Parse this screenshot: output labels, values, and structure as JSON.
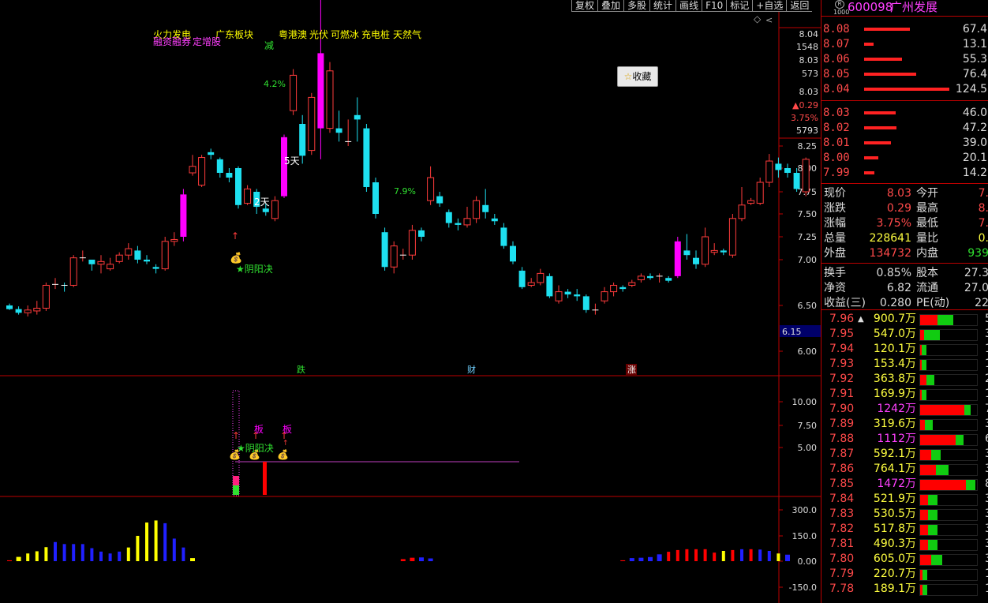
{
  "toolbar": [
    "复权",
    "叠加",
    "多股",
    "统计",
    "画线",
    "F10",
    "标记",
    "+自选",
    "返回"
  ],
  "stock": {
    "badge_r": "R",
    "badge_n": "1000",
    "code": "600098",
    "name": "广州发展"
  },
  "favorite": {
    "icon": "star-icon",
    "label": "收藏"
  },
  "concepts": [
    {
      "text": "火力发电",
      "color": "#ffff00"
    },
    {
      "text": "广东板块",
      "color": "#ffff00"
    },
    {
      "text": "粤港澳",
      "color": "#ffff00"
    },
    {
      "text": "光伏",
      "color": "#ffff00"
    },
    {
      "text": "可燃冰",
      "color": "#ffff00"
    },
    {
      "text": "充电桩",
      "color": "#ffff00"
    },
    {
      "text": "天然气",
      "color": "#ffff00"
    },
    {
      "text": "融资融券",
      "color": "#ff40ff"
    },
    {
      "text": "定增股",
      "color": "#ff40ff"
    }
  ],
  "chart_labels": {
    "jian": "减",
    "pct1": "4.2%",
    "pct2": "7.9%",
    "day5": "5天",
    "day2": "2天",
    "yyj": "阴阳决",
    "ban": "板",
    "die": "跌",
    "cai": "财",
    "zhang": "涨"
  },
  "chart_data": [
    {
      "type": "candlestick",
      "name": "price",
      "ylim": [
        5.7,
        8.5
      ],
      "yticks": [
        "6.00",
        "6.50",
        "7.00",
        "7.25",
        "7.50",
        "7.75",
        "8.00",
        "8.25"
      ],
      "yticks_top": [
        "8.04",
        "1548",
        "8.03",
        "573",
        "8.03",
        "▲0.29",
        "3.75%",
        "5793"
      ],
      "current_price_marker": "6.15",
      "candles": [
        [
          6.5,
          6.46,
          6.52,
          6.45
        ],
        [
          6.46,
          6.42,
          6.49,
          6.4
        ],
        [
          6.42,
          6.45,
          6.5,
          6.38
        ],
        [
          6.44,
          6.47,
          6.55,
          6.4
        ],
        [
          6.47,
          6.72,
          6.75,
          6.44
        ],
        [
          6.72,
          6.73,
          6.8,
          6.68
        ],
        [
          6.73,
          6.72,
          6.75,
          6.65
        ],
        [
          6.72,
          7.02,
          7.05,
          6.7
        ],
        [
          7.02,
          7.02,
          7.1,
          6.98
        ],
        [
          7.0,
          6.95,
          7.0,
          6.88
        ],
        [
          6.95,
          6.98,
          7.05,
          6.85
        ],
        [
          6.9,
          6.95,
          7.02,
          6.88
        ],
        [
          6.98,
          7.05,
          7.08,
          6.96
        ],
        [
          7.05,
          7.12,
          7.18,
          7.0
        ],
        [
          7.1,
          7.0,
          7.15,
          6.96
        ],
        [
          7.0,
          6.98,
          7.05,
          6.95
        ],
        [
          6.92,
          6.9,
          6.95,
          6.85
        ],
        [
          6.9,
          7.2,
          7.25,
          6.88
        ],
        [
          7.2,
          7.22,
          7.3,
          7.15
        ],
        [
          7.25,
          7.72,
          7.78,
          7.2
        ],
        [
          7.95,
          8.02,
          8.15,
          7.92
        ],
        [
          7.82,
          8.12,
          8.15,
          7.8
        ],
        [
          8.18,
          8.15,
          8.22,
          8.1
        ],
        [
          8.1,
          7.95,
          8.12,
          7.9
        ],
        [
          7.95,
          7.9,
          8.0,
          7.85
        ],
        [
          8.0,
          7.6,
          8.02,
          7.56
        ],
        [
          7.62,
          7.78,
          7.82,
          7.6
        ],
        [
          7.75,
          7.58,
          7.78,
          7.5
        ],
        [
          7.56,
          7.52,
          7.62,
          7.48
        ],
        [
          7.45,
          7.65,
          7.7,
          7.42
        ],
        [
          7.7,
          8.35,
          8.38,
          7.68
        ],
        [
          8.65,
          9.05,
          9.12,
          8.6
        ],
        [
          8.5,
          8.14,
          8.6,
          8.05
        ],
        [
          8.2,
          8.8,
          8.85,
          8.15
        ],
        [
          8.45,
          9.3,
          9.95,
          8.1
        ],
        [
          8.45,
          9.1,
          9.2,
          8.4
        ],
        [
          8.45,
          8.4,
          8.65,
          8.3
        ],
        [
          8.3,
          8.3,
          8.55,
          8.25
        ],
        [
          8.6,
          8.55,
          8.8,
          8.3
        ],
        [
          8.45,
          7.8,
          8.5,
          7.75
        ],
        [
          7.85,
          7.5,
          7.9,
          7.45
        ],
        [
          7.3,
          6.92,
          7.35,
          6.88
        ],
        [
          6.92,
          7.15,
          7.2,
          6.85
        ],
        [
          7.05,
          7.05,
          7.12,
          7.0
        ],
        [
          7.05,
          7.32,
          7.38,
          7.0
        ],
        [
          7.32,
          7.25,
          7.35,
          7.2
        ],
        [
          7.65,
          7.9,
          8.02,
          7.6
        ],
        [
          7.7,
          7.62,
          7.75,
          7.58
        ],
        [
          7.52,
          7.4,
          7.55,
          7.35
        ],
        [
          7.4,
          7.38,
          7.45,
          7.32
        ],
        [
          7.38,
          7.45,
          7.58,
          7.35
        ],
        [
          7.45,
          7.65,
          7.7,
          7.4
        ],
        [
          7.6,
          7.52,
          7.78,
          7.45
        ],
        [
          7.45,
          7.42,
          7.5,
          7.38
        ],
        [
          7.35,
          7.15,
          7.4,
          7.12
        ],
        [
          7.15,
          6.98,
          7.2,
          6.95
        ],
        [
          6.88,
          6.7,
          6.92,
          6.68
        ],
        [
          6.72,
          6.75,
          6.8,
          6.7
        ],
        [
          6.75,
          6.85,
          6.9,
          6.72
        ],
        [
          6.82,
          6.6,
          6.85,
          6.58
        ],
        [
          6.55,
          6.65,
          6.72,
          6.52
        ],
        [
          6.65,
          6.62,
          6.68,
          6.58
        ],
        [
          6.62,
          6.6,
          6.68,
          6.55
        ],
        [
          6.6,
          6.45,
          6.62,
          6.42
        ],
        [
          6.45,
          6.45,
          6.52,
          6.4
        ],
        [
          6.55,
          6.65,
          6.7,
          6.52
        ],
        [
          6.65,
          6.72,
          6.75,
          6.6
        ],
        [
          6.7,
          6.68,
          6.72,
          6.65
        ],
        [
          6.72,
          6.75,
          6.78,
          6.7
        ],
        [
          6.78,
          6.82,
          6.85,
          6.75
        ],
        [
          6.82,
          6.8,
          6.85,
          6.78
        ],
        [
          6.82,
          6.82,
          6.85,
          6.75
        ],
        [
          6.8,
          6.77,
          6.82,
          6.75
        ],
        [
          6.82,
          7.2,
          7.25,
          6.8
        ],
        [
          7.1,
          7.05,
          7.28,
          7.0
        ],
        [
          7.02,
          6.95,
          7.1,
          6.9
        ],
        [
          6.95,
          7.25,
          7.35,
          6.92
        ],
        [
          7.08,
          7.1,
          7.18,
          7.05
        ],
        [
          7.1,
          7.08,
          7.12,
          7.05
        ],
        [
          7.05,
          7.45,
          7.5,
          7.02
        ],
        [
          7.45,
          7.6,
          7.8,
          7.42
        ],
        [
          7.62,
          7.65,
          7.68,
          7.6
        ],
        [
          7.62,
          7.85,
          7.9,
          7.6
        ],
        [
          7.85,
          8.08,
          8.16,
          7.8
        ],
        [
          8.05,
          7.98,
          8.12,
          7.9
        ],
        [
          8.0,
          7.95,
          8.05,
          7.9
        ],
        [
          7.95,
          7.78,
          8.0,
          7.75
        ],
        [
          7.75,
          8.1,
          8.12,
          7.7
        ]
      ]
    },
    {
      "type": "bar",
      "name": "indicator",
      "yticks": [
        "10.00",
        "7.50",
        "5.00"
      ]
    },
    {
      "type": "bar",
      "name": "volume-osc",
      "yticks": [
        "300.0",
        "150.0",
        "0.00",
        "-150.0"
      ],
      "values": [
        5,
        25,
        45,
        58,
        82,
        112,
        100,
        100,
        100,
        76,
        56,
        45,
        56,
        80,
        148,
        226,
        238,
        222,
        132,
        80,
        18,
        0,
        0,
        0,
        0,
        0,
        0,
        0,
        0,
        0,
        0,
        0,
        0,
        0,
        0,
        0,
        0,
        0,
        0,
        0,
        0,
        0,
        0,
        12,
        20,
        22,
        16,
        0,
        0,
        0,
        0,
        0,
        0,
        0,
        0,
        0,
        0,
        0,
        0,
        0,
        0,
        0,
        0,
        0,
        0,
        0,
        0,
        5,
        18,
        20,
        24,
        40,
        55,
        65,
        70,
        70,
        70,
        50,
        60,
        65,
        70,
        70,
        68,
        60,
        45,
        38
      ]
    }
  ],
  "order_book": {
    "asks": [
      {
        "p": "8.08",
        "v": "67.4",
        "w": 58
      },
      {
        "p": "8.07",
        "v": "13.1",
        "w": 12
      },
      {
        "p": "8.06",
        "v": "55.3",
        "w": 48
      },
      {
        "p": "8.05",
        "v": "76.4",
        "w": 66
      },
      {
        "p": "8.04",
        "v": "124.5",
        "w": 108
      }
    ],
    "bids": [
      {
        "p": "8.03",
        "v": "46.0",
        "w": 40
      },
      {
        "p": "8.02",
        "v": "47.2",
        "w": 41
      },
      {
        "p": "8.01",
        "v": "39.0",
        "w": 34
      },
      {
        "p": "8.00",
        "v": "20.1",
        "w": 18
      },
      {
        "p": "7.99",
        "v": "14.2",
        "w": 13
      }
    ]
  },
  "quote": [
    {
      "l": "现价",
      "v": "8.03",
      "c": "#ff4a4a",
      "l2": "今开",
      "v2": "7.",
      "c2": "#ff4a4a"
    },
    {
      "l": "涨跌",
      "v": "0.29",
      "c": "#ff4a4a",
      "l2": "最高",
      "v2": "8.",
      "c2": "#ff4a4a"
    },
    {
      "l": "涨幅",
      "v": "3.75%",
      "c": "#ff4a4a",
      "l2": "最低",
      "v2": "7.",
      "c2": "#ff4a4a"
    },
    {
      "l": "总量",
      "v": "228641",
      "c": "#ffff40",
      "l2": "量比",
      "v2": "0.",
      "c2": "#ffff40"
    },
    {
      "l": "外盘",
      "v": "134732",
      "c": "#ff4a4a",
      "l2": "内盘",
      "v2": "939",
      "c2": "#30e030"
    },
    {
      "l": "换手",
      "v": "0.85%",
      "c": "#ddd",
      "l2": "股本",
      "v2": "27.3",
      "c2": "#ddd"
    },
    {
      "l": "净资",
      "v": "6.82",
      "c": "#ddd",
      "l2": "流通",
      "v2": "27.0",
      "c2": "#ddd"
    },
    {
      "l": "收益(三)",
      "v": "0.280",
      "c": "#ddd",
      "l2": "PE(动)",
      "v2": "22",
      "c2": "#ddd"
    }
  ],
  "levels": [
    {
      "p": "7.96",
      "v": "900.7万",
      "c": "#ffff40",
      "r": 22,
      "g": 20,
      "n": "5",
      "arrow": "▲"
    },
    {
      "p": "7.95",
      "v": "547.0万",
      "c": "#ffff40",
      "r": 5,
      "g": 20,
      "n": "3"
    },
    {
      "p": "7.94",
      "v": "120.1万",
      "c": "#ffff40",
      "r": 2,
      "g": 6,
      "n": "1"
    },
    {
      "p": "7.93",
      "v": "153.4万",
      "c": "#ffff40",
      "r": 2,
      "g": 6,
      "n": "1"
    },
    {
      "p": "7.92",
      "v": "363.8万",
      "c": "#ffff40",
      "r": 8,
      "g": 10,
      "n": "2"
    },
    {
      "p": "7.91",
      "v": "169.9万",
      "c": "#ffff40",
      "r": 2,
      "g": 6,
      "n": "1"
    },
    {
      "p": "7.90",
      "v": "1242万",
      "c": "#ff40ff",
      "r": 56,
      "g": 8,
      "n": "7"
    },
    {
      "p": "7.89",
      "v": "319.6万",
      "c": "#ffff40",
      "r": 6,
      "g": 10,
      "n": "3"
    },
    {
      "p": "7.88",
      "v": "1112万",
      "c": "#ff40ff",
      "r": 45,
      "g": 10,
      "n": "6"
    },
    {
      "p": "7.87",
      "v": "592.1万",
      "c": "#ffff40",
      "r": 14,
      "g": 12,
      "n": "3"
    },
    {
      "p": "7.86",
      "v": "764.1万",
      "c": "#ffff40",
      "r": 20,
      "g": 16,
      "n": "3"
    },
    {
      "p": "7.85",
      "v": "1472万",
      "c": "#ff40ff",
      "r": 58,
      "g": 12,
      "n": "8"
    },
    {
      "p": "7.84",
      "v": "521.9万",
      "c": "#ffff40",
      "r": 10,
      "g": 12,
      "n": "3"
    },
    {
      "p": "7.83",
      "v": "530.5万",
      "c": "#ffff40",
      "r": 10,
      "g": 12,
      "n": "3"
    },
    {
      "p": "7.82",
      "v": "517.8万",
      "c": "#ffff40",
      "r": 10,
      "g": 12,
      "n": "3"
    },
    {
      "p": "7.81",
      "v": "490.3万",
      "c": "#ffff40",
      "r": 10,
      "g": 12,
      "n": "3"
    },
    {
      "p": "7.80",
      "v": "605.0万",
      "c": "#ffff40",
      "r": 14,
      "g": 14,
      "n": "3"
    },
    {
      "p": "7.79",
      "v": "220.7万",
      "c": "#ffff40",
      "r": 3,
      "g": 6,
      "n": "1"
    },
    {
      "p": "7.78",
      "v": "189.1万",
      "c": "#ffff40",
      "r": 3,
      "g": 6,
      "n": "1"
    }
  ]
}
